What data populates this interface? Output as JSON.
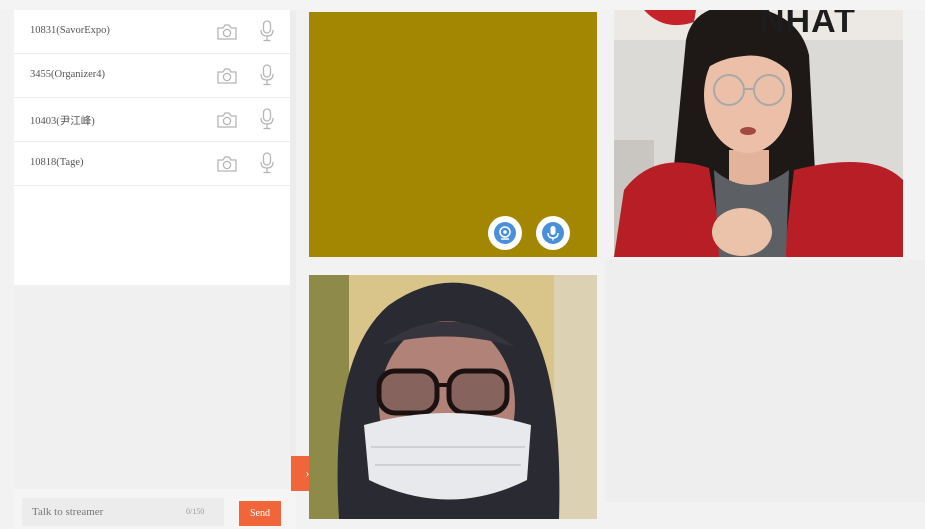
{
  "participants": [
    {
      "name": "10831(SavorExpo)"
    },
    {
      "name": "3455(Organizer4)"
    },
    {
      "name": "10403(尹江峰)"
    },
    {
      "name": "10818(Tage)"
    }
  ],
  "chat": {
    "placeholder": "Talk to streamer",
    "counter": "0/150",
    "send_label": "Send"
  },
  "toggle_label": "›",
  "tiles": {
    "banner_text": "NHAT"
  },
  "colors": {
    "accent": "#f0663a",
    "tile_yellow": "#a38702",
    "tile_button": "#4a90d9"
  }
}
